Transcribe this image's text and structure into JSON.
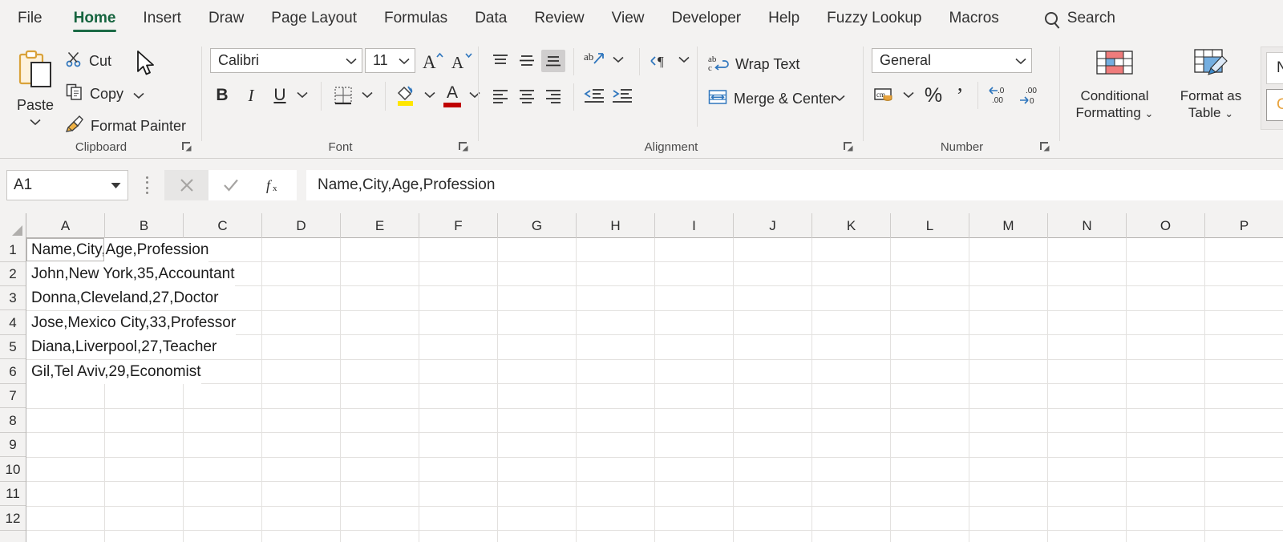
{
  "tabs": [
    {
      "label": "File",
      "active": false
    },
    {
      "label": "Home",
      "active": true
    },
    {
      "label": "Insert",
      "active": false
    },
    {
      "label": "Draw",
      "active": false
    },
    {
      "label": "Page Layout",
      "active": false
    },
    {
      "label": "Formulas",
      "active": false
    },
    {
      "label": "Data",
      "active": false
    },
    {
      "label": "Review",
      "active": false
    },
    {
      "label": "View",
      "active": false
    },
    {
      "label": "Developer",
      "active": false
    },
    {
      "label": "Help",
      "active": false
    },
    {
      "label": "Fuzzy Lookup",
      "active": false
    },
    {
      "label": "Macros",
      "active": false
    }
  ],
  "search": {
    "label": "Search",
    "icon": "search-icon"
  },
  "ribbon": {
    "clipboard": {
      "group_label": "Clipboard",
      "paste_label": "Paste",
      "cut_label": "Cut",
      "copy_label": "Copy",
      "format_painter_label": "Format Painter"
    },
    "font": {
      "group_label": "Font",
      "font_name": "Calibri",
      "font_size": "11",
      "bold_label": "B",
      "italic_label": "I",
      "underline_label": "U",
      "grow_font_label": "A",
      "shrink_font_label": "A",
      "font_color_label": "A"
    },
    "alignment": {
      "group_label": "Alignment",
      "wrap_text_label": "Wrap Text",
      "merge_center_label": "Merge & Center"
    },
    "number": {
      "group_label": "Number",
      "format_value": "General",
      "percent_label": "%",
      "comma_label": "’"
    },
    "styles": {
      "conditional_formatting_label": "Conditional\nFormatting",
      "conditional_formatting_line1": "Conditional",
      "conditional_formatting_line2": "Formatting",
      "format_as_table_line1": "Format as",
      "format_as_table_line2": "Table",
      "cell_style_normal": "Nor",
      "cell_style_calculation": "Calc"
    }
  },
  "formula_bar": {
    "name_box_value": "A1",
    "cancel_icon": "close-icon",
    "confirm_icon": "check-icon",
    "function_icon": "fx-icon",
    "formula_value": "Name,City,Age,Profession"
  },
  "sheet": {
    "columns": [
      "A",
      "B",
      "C",
      "D",
      "E",
      "F",
      "G",
      "H",
      "I",
      "J",
      "K",
      "L",
      "M",
      "N",
      "O",
      "P"
    ],
    "rows": [
      "1",
      "2",
      "3",
      "4",
      "5",
      "6",
      "7",
      "8",
      "9",
      "10",
      "11",
      "12"
    ],
    "active_cell": "A1",
    "cell_values": [
      "Name,City,Age,Profession",
      "John,New York,35,Accountant",
      "Donna,Cleveland,27,Doctor",
      "Jose,Mexico City,33,Professor",
      "Diana,Liverpool,27,Teacher",
      "Gil,Tel Aviv,29,Economist",
      "",
      "",
      "",
      "",
      "",
      ""
    ]
  },
  "colors": {
    "accent_green": "#1b6b46",
    "ribbon_bg": "#f3f2f1",
    "grid_line": "#e3e1df",
    "header_text": "#2b2b2b",
    "style_calc_text": "#e8a33d"
  }
}
